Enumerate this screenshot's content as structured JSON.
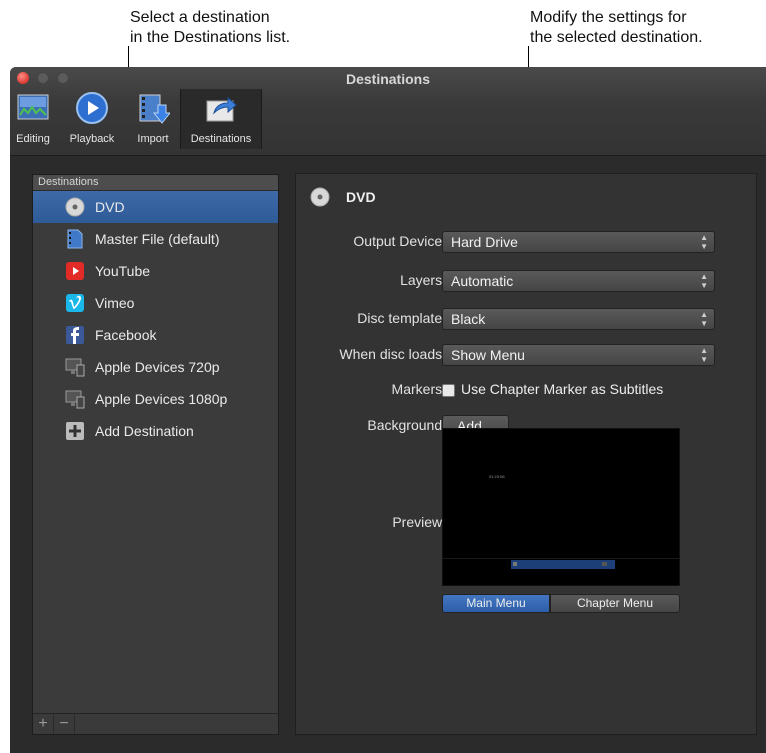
{
  "callouts": {
    "left": {
      "line1": "Select a destination",
      "line2": "in the Destinations list."
    },
    "right": {
      "line1": "Modify the settings for",
      "line2": "the selected destination."
    }
  },
  "window": {
    "title": "Destinations"
  },
  "toolbar": {
    "items": [
      {
        "label": "Editing",
        "icon": "editing-icon"
      },
      {
        "label": "Playback",
        "icon": "playback-icon"
      },
      {
        "label": "Import",
        "icon": "import-icon"
      },
      {
        "label": "Destinations",
        "icon": "destinations-icon",
        "active": true
      }
    ]
  },
  "sidebar": {
    "header": "Destinations",
    "items": [
      {
        "label": "DVD",
        "icon": "dvd-icon",
        "selected": true
      },
      {
        "label": "Master File (default)",
        "icon": "master-file-icon"
      },
      {
        "label": "YouTube",
        "icon": "youtube-icon"
      },
      {
        "label": "Vimeo",
        "icon": "vimeo-icon"
      },
      {
        "label": "Facebook",
        "icon": "facebook-icon"
      },
      {
        "label": "Apple Devices 720p",
        "icon": "apple-devices-icon"
      },
      {
        "label": "Apple Devices 1080p",
        "icon": "apple-devices-icon"
      },
      {
        "label": "Add Destination",
        "icon": "add-icon"
      }
    ],
    "footer": {
      "add": "+",
      "remove": "−"
    }
  },
  "panel": {
    "title": "DVD",
    "output_device": {
      "label": "Output Device:",
      "value": "Hard Drive"
    },
    "layers": {
      "label": "Layers:",
      "value": "Automatic"
    },
    "disc_template": {
      "label": "Disc template:",
      "value": "Black"
    },
    "when_disc_loads": {
      "label": "When disc loads:",
      "value": "Show Menu"
    },
    "markers": {
      "label": "Markers:",
      "checkbox_label": "Use Chapter Marker as Subtitles",
      "checked": false
    },
    "background": {
      "label": "Background:",
      "button": "Add..."
    },
    "preview": {
      "label": "Preview:",
      "timecode": "01:23:06"
    },
    "menu_toggle": {
      "main": "Main Menu",
      "chapter": "Chapter Menu",
      "selected": "Main Menu"
    }
  },
  "colors": {
    "selection": "#2e5a97",
    "window_bg": "#2b2b2b",
    "close": "#e0443b"
  }
}
